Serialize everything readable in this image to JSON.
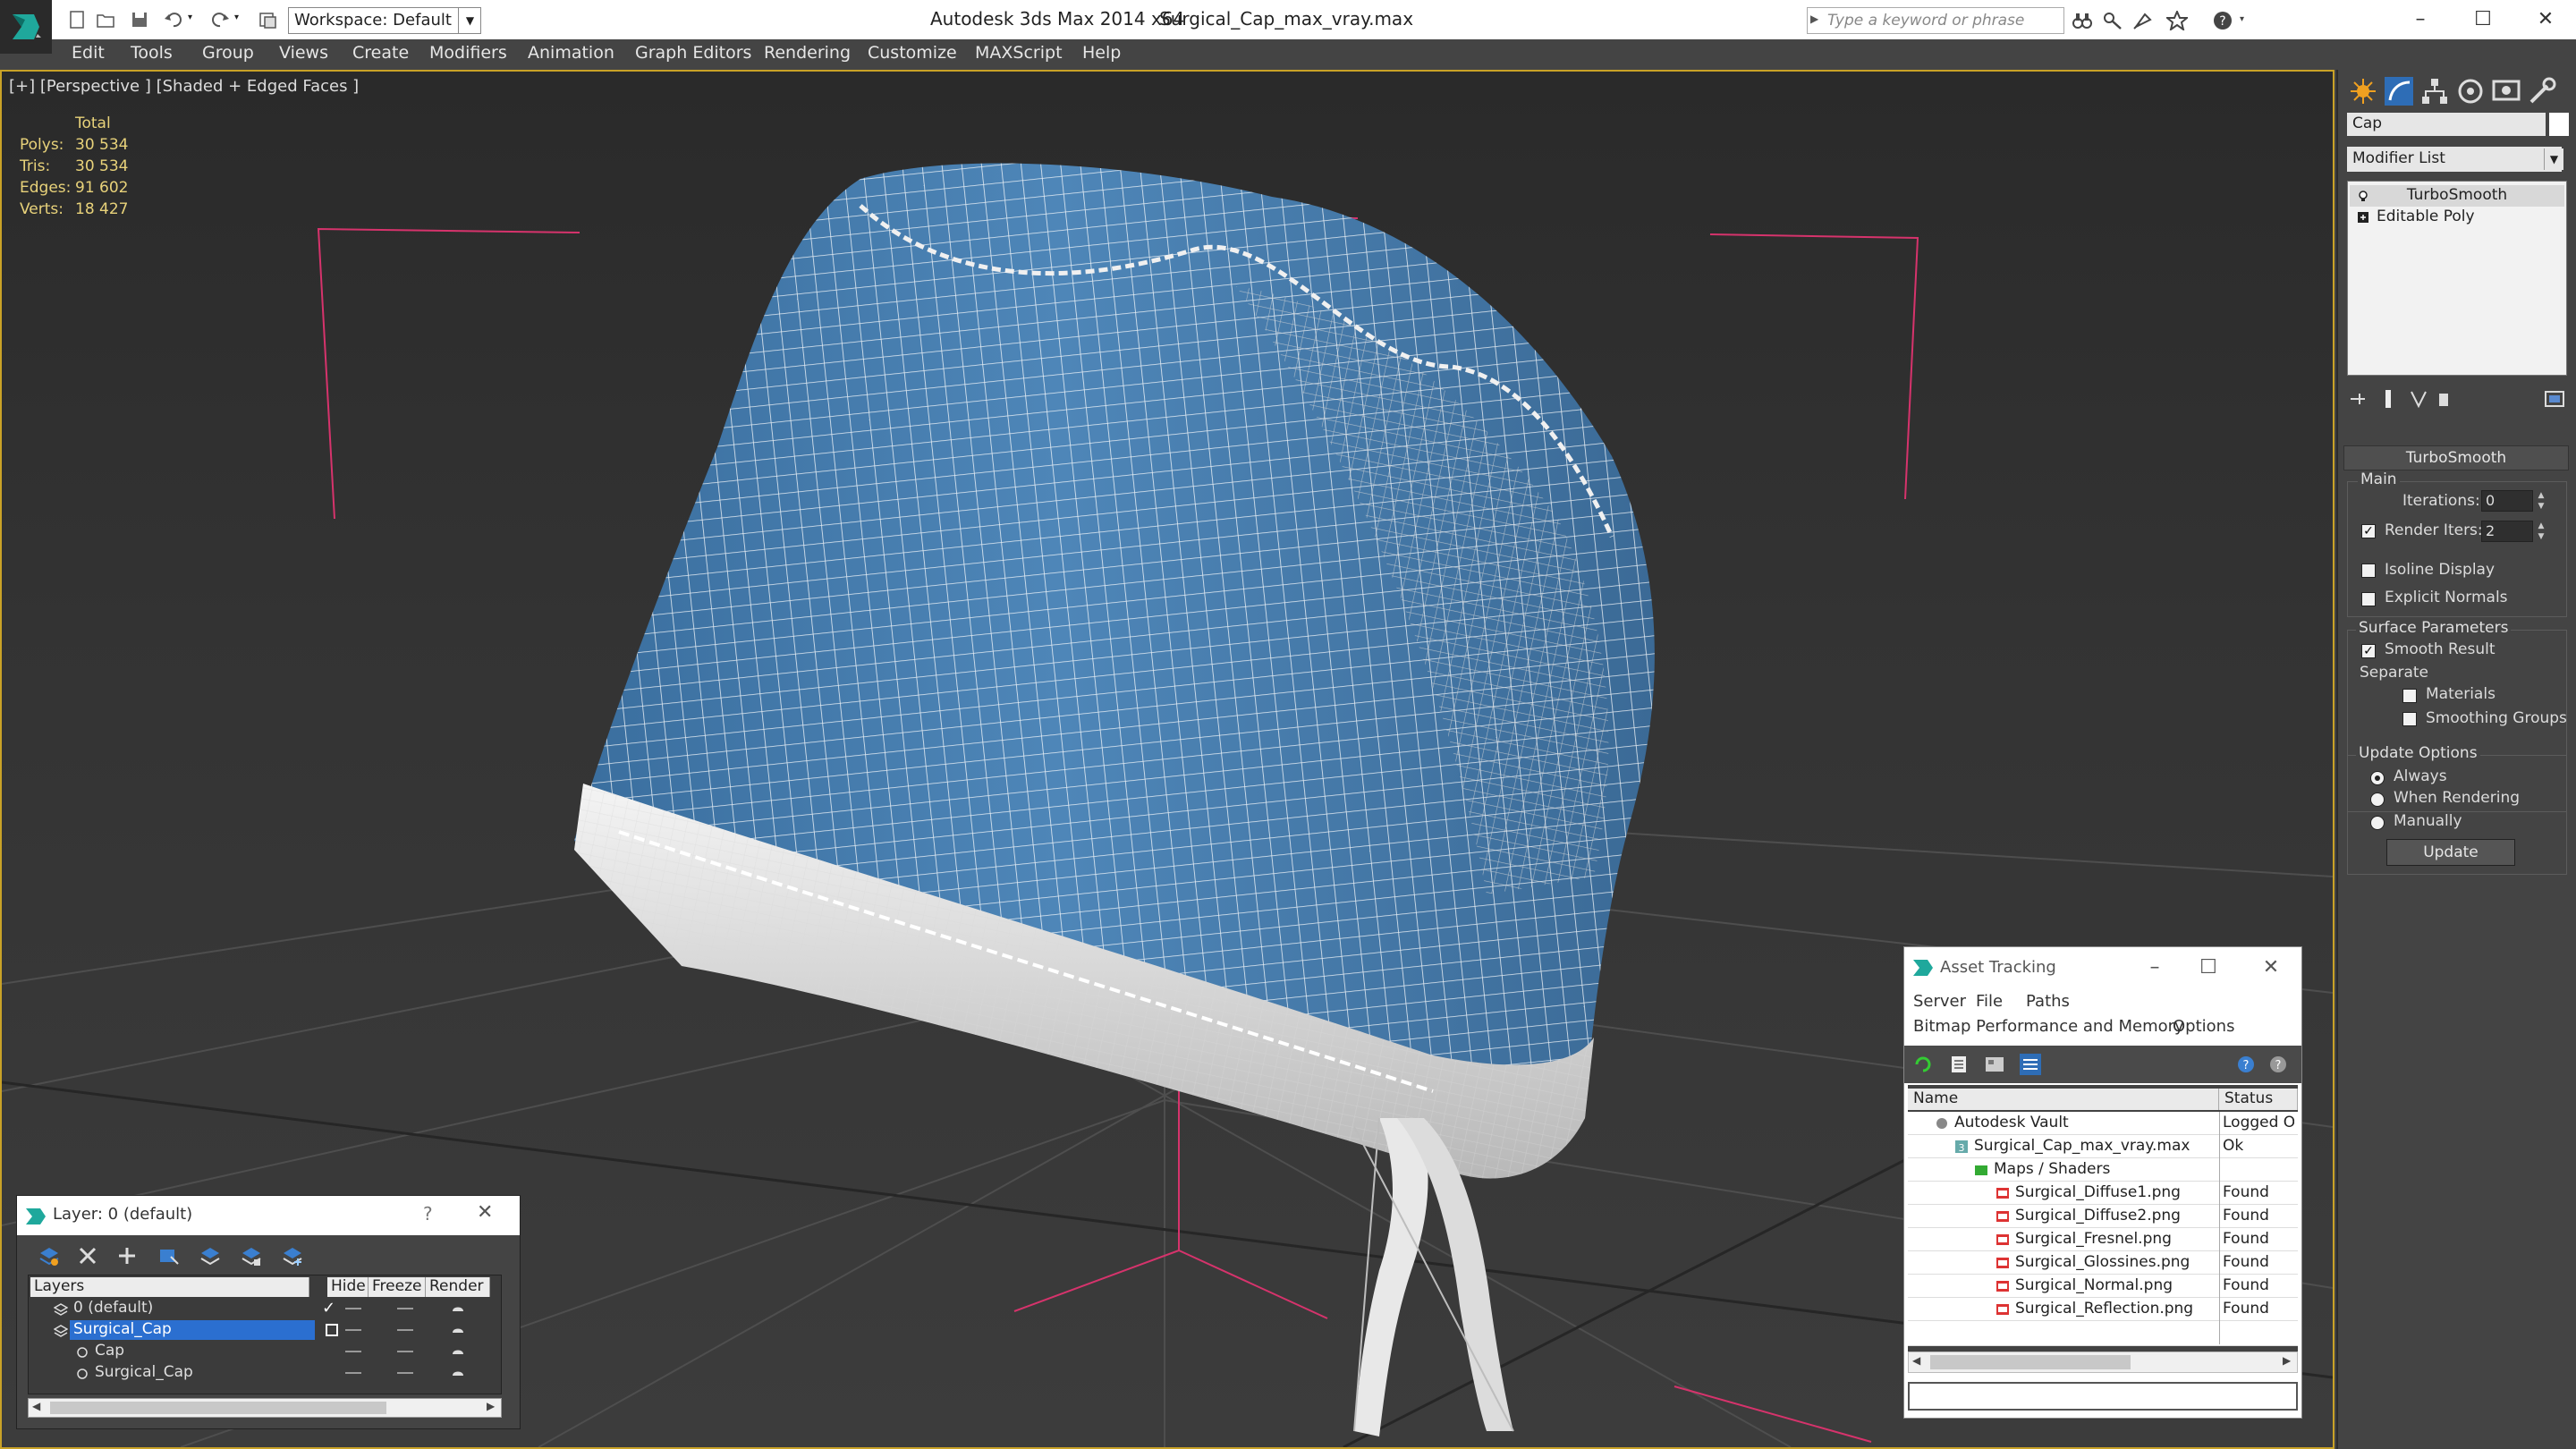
{
  "title_bar": {
    "workspace_label": "Workspace: Default",
    "app_name": "Autodesk 3ds Max  2014 x64",
    "file_name": "Surgical_Cap_max_vray.max",
    "search_placeholder": "Type a keyword or phrase",
    "minimize": "–",
    "maximize": "☐",
    "close": "✕",
    "help": "?"
  },
  "menu": [
    "Edit",
    "Tools",
    "Group",
    "Views",
    "Create",
    "Modifiers",
    "Animation",
    "Graph Editors",
    "Rendering",
    "Customize",
    "MAXScript",
    "Help"
  ],
  "viewport": {
    "label": "[+] [Perspective ] [Shaded + Edged Faces ]",
    "stats_header": "Total",
    "stats": [
      {
        "label": "Polys:",
        "value": "30 534"
      },
      {
        "label": "Tris:",
        "value": "30 534"
      },
      {
        "label": "Edges:",
        "value": "91 602"
      },
      {
        "label": "Verts:",
        "value": "18 427"
      }
    ],
    "mesh_color": "#4a7fb0",
    "wire_color": "#ffffff",
    "grid_color": "#555555",
    "bbox_color": "#d6336c"
  },
  "command_panel": {
    "object_name": "Cap",
    "modifier_list": "Modifier List",
    "stack": [
      {
        "label": "TurboSmooth",
        "selected": true
      },
      {
        "label": "Editable Poly",
        "selected": false
      }
    ],
    "rollout_title": "TurboSmooth",
    "main_group": "Main",
    "iterations_label": "Iterations:",
    "iterations_value": "0",
    "render_iters_label": "Render Iters:",
    "render_iters_value": "2",
    "render_iters_checked": "✓",
    "isoline_label": "Isoline Display",
    "explicit_normals_label": "Explicit Normals",
    "surface_group": "Surface Parameters",
    "smooth_result_label": "Smooth Result",
    "smooth_result_checked": "✓",
    "separate_label": "Separate",
    "materials_label": "Materials",
    "smoothing_groups_label": "Smoothing Groups",
    "update_group": "Update Options",
    "always_label": "Always",
    "when_rendering_label": "When Rendering",
    "manually_label": "Manually",
    "update_button": "Update"
  },
  "asset_tracking": {
    "title": "Asset Tracking",
    "menu_row1": [
      "Server",
      "File",
      "Paths"
    ],
    "menu_row2": [
      "Bitmap Performance and Memory",
      "Options"
    ],
    "col_name": "Name",
    "col_status": "Status",
    "rows": [
      {
        "name": "Autodesk Vault",
        "status": "Logged O",
        "indent": 0,
        "icon": "vault-icon"
      },
      {
        "name": "Surgical_Cap_max_vray.max",
        "status": "Ok",
        "indent": 1,
        "icon": "max-file-icon"
      },
      {
        "name": "Maps / Shaders",
        "status": "",
        "indent": 2,
        "icon": "maps-folder-icon"
      },
      {
        "name": "Surgical_Diffuse1.png",
        "status": "Found",
        "indent": 3,
        "icon": "png-icon"
      },
      {
        "name": "Surgical_Diffuse2.png",
        "status": "Found",
        "indent": 3,
        "icon": "png-icon"
      },
      {
        "name": "Surgical_Fresnel.png",
        "status": "Found",
        "indent": 3,
        "icon": "png-icon"
      },
      {
        "name": "Surgical_Glossines.png",
        "status": "Found",
        "indent": 3,
        "icon": "png-icon"
      },
      {
        "name": "Surgical_Normal.png",
        "status": "Found",
        "indent": 3,
        "icon": "png-icon"
      },
      {
        "name": "Surgical_Reflection.png",
        "status": "Found",
        "indent": 3,
        "icon": "png-icon"
      }
    ]
  },
  "layer_manager": {
    "title": "Layer: 0 (default)",
    "help": "?",
    "close": "✕",
    "col_layers": "Layers",
    "col_hide": "Hide",
    "col_freeze": "Freeze",
    "col_render": "Render",
    "rows": [
      {
        "name": "0 (default)",
        "indent": 1,
        "selected": false,
        "check": "✓"
      },
      {
        "name": "Surgical_Cap",
        "indent": 1,
        "selected": true,
        "check": ""
      },
      {
        "name": "Cap",
        "indent": 2,
        "selected": false,
        "check": ""
      },
      {
        "name": "Surgical_Cap",
        "indent": 2,
        "selected": false,
        "check": ""
      }
    ]
  }
}
